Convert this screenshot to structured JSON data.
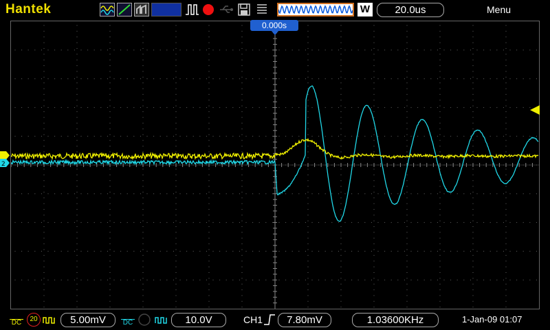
{
  "top": {
    "brand": "Hantek",
    "timebase_mode": "W",
    "timebase": "20.0us",
    "menu": "Menu"
  },
  "screen": {
    "trigger_time": "0.000s"
  },
  "bottom": {
    "ch1": {
      "coupling": "DC",
      "bw_limit": "20",
      "volts_per_div": "5.00mV"
    },
    "ch2": {
      "coupling": "DC",
      "volts_per_div": "10.0V"
    },
    "trigger": {
      "source": "CH1",
      "level": "7.80mV"
    },
    "frequency": "1.03600KHz",
    "datetime": "1-Jan-09 01:07"
  },
  "colors": {
    "ch1": "#f0f000",
    "ch2": "#20d8e8",
    "brand": "#f0e000",
    "accent": "#2060d0"
  },
  "icons": [
    "run-state-icon",
    "stop-icon",
    "save-icon",
    "usb-icon",
    "trigger-edge-icon"
  ]
}
